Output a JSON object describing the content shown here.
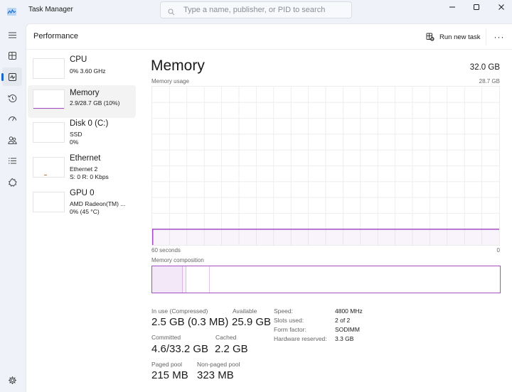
{
  "window": {
    "title": "Task Manager",
    "search_placeholder": "Type a name, publisher, or PID to search",
    "controls": [
      "minimize",
      "maximize",
      "close"
    ]
  },
  "nav": {
    "items": [
      {
        "name": "hamburger-menu",
        "icon": "menu-icon"
      },
      {
        "name": "processes",
        "icon": "processes-icon"
      },
      {
        "name": "performance",
        "icon": "performance-icon",
        "active": true
      },
      {
        "name": "app-history",
        "icon": "history-icon"
      },
      {
        "name": "startup-apps",
        "icon": "startup-icon"
      },
      {
        "name": "users",
        "icon": "users-icon"
      },
      {
        "name": "details",
        "icon": "details-icon"
      },
      {
        "name": "services",
        "icon": "services-icon"
      }
    ],
    "settings_icon": "gear-icon",
    "accent_color": "#1964c5"
  },
  "header": {
    "title": "Performance",
    "run_new_task": "Run new task",
    "more": "···"
  },
  "devices": [
    {
      "title": "CPU",
      "line1": "0% 3.60 GHz",
      "line2": ""
    },
    {
      "title": "Memory",
      "line1": "2.9/28.7 GB (10%)",
      "line2": "",
      "selected": true
    },
    {
      "title": "Disk 0 (C:)",
      "line1": "SSD",
      "line2": "0%"
    },
    {
      "title": "Ethernet",
      "line1": "Ethernet 2",
      "line2": "S: 0 R: 0 Kbps"
    },
    {
      "title": "GPU 0",
      "line1": "AMD Radeon(TM) ...",
      "line2": "0% (45 °C)"
    }
  ],
  "memory": {
    "title": "Memory",
    "total": "32.0 GB",
    "usage_label": "Memory usage",
    "usage_max": "28.7 GB",
    "time_left": "60 seconds",
    "time_right": "0",
    "composition_label": "Memory composition",
    "accent_color": "#a54fc4",
    "usage_fraction": 0.1,
    "composition": {
      "in_use_fraction": 0.087,
      "modified_fraction": 0.012,
      "standby_fraction": 0.066
    },
    "stats": {
      "in_use_label": "In use (Compressed)",
      "in_use_value": "2.5 GB (0.3 MB)",
      "available_label": "Available",
      "available_value": "25.9 GB",
      "committed_label": "Committed",
      "committed_value": "4.6/33.2 GB",
      "cached_label": "Cached",
      "cached_value": "2.2 GB",
      "paged_pool_label": "Paged pool",
      "paged_pool_value": "215 MB",
      "non_paged_pool_label": "Non-paged pool",
      "non_paged_pool_value": "323 MB"
    },
    "specs": [
      {
        "key": "Speed:",
        "value": "4800 MHz"
      },
      {
        "key": "Slots used:",
        "value": "2 of 2"
      },
      {
        "key": "Form factor:",
        "value": "SODIMM"
      },
      {
        "key": "Hardware reserved:",
        "value": "3.3 GB"
      }
    ]
  }
}
